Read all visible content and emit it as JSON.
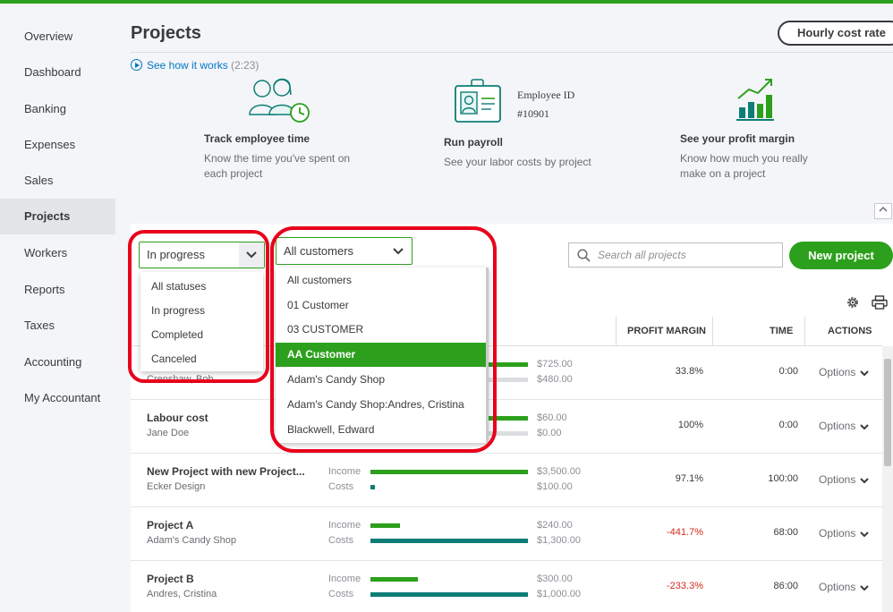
{
  "sidebar": {
    "items": [
      {
        "label": "Overview"
      },
      {
        "label": "Dashboard"
      },
      {
        "label": "Banking"
      },
      {
        "label": "Expenses"
      },
      {
        "label": "Sales"
      },
      {
        "label": "Projects"
      },
      {
        "label": "Workers"
      },
      {
        "label": "Reports"
      },
      {
        "label": "Taxes"
      },
      {
        "label": "Accounting"
      },
      {
        "label": "My Accountant"
      }
    ],
    "active": "Projects"
  },
  "header": {
    "title": "Projects",
    "hourly_cost_label": "Hourly cost rate",
    "see_how_label": "See how it works",
    "see_how_duration": "(2:23)"
  },
  "features": [
    {
      "title": "Track employee time",
      "desc": "Know the time you've spent on each project",
      "icon": "employees-clock-icon"
    },
    {
      "title": "Run payroll",
      "desc": "See your labor costs by project",
      "icon": "id-badge-icon",
      "badge_line1": "Employee ID",
      "badge_line2": "#10901"
    },
    {
      "title": "See your profit margin",
      "desc": "Know how much you really make on a project",
      "icon": "bar-chart-icon"
    }
  ],
  "filters": {
    "status_selected": "In progress",
    "status_options": [
      "All statuses",
      "In progress",
      "Completed",
      "Canceled"
    ],
    "customer_selected": "All customers",
    "customer_options": [
      "All customers",
      "01 Customer",
      "03 CUSTOMER",
      "AA Customer",
      "Adam's Candy Shop",
      "Adam's Candy Shop:Andres, Cristina",
      "Blackwell, Edward"
    ],
    "customer_highlighted": "AA Customer",
    "search_placeholder": "Search all projects",
    "new_project_label": "New project"
  },
  "table": {
    "columns": {
      "profit_margin": "PROFIT MARGIN",
      "time": "TIME",
      "actions": "ACTIONS"
    },
    "income_label": "Income",
    "costs_label": "Costs",
    "options_label": "Options",
    "rows": [
      {
        "name": "",
        "customer": "Crenshaw, Bob",
        "income": "$725.00",
        "costs": "$480.00",
        "margin": "33.8%",
        "time": "0:00",
        "income_frac": 0.21,
        "costs_frac": 0.14
      },
      {
        "name": "Labour cost",
        "customer": "Jane Doe",
        "income": "$60.00",
        "costs": "$0.00",
        "margin": "100%",
        "time": "0:00",
        "income_frac": 0.02,
        "costs_frac": 0.0
      },
      {
        "name": "New Project with new Project...",
        "customer": "Ecker Design",
        "income": "$3,500.00",
        "costs": "$100.00",
        "margin": "97.1%",
        "time": "100:00",
        "income_frac": 1.0,
        "costs_frac": 0.03
      },
      {
        "name": "Project A",
        "customer": "Adam's Candy Shop",
        "income": "$240.00",
        "costs": "$1,300.00",
        "margin": "-441.7%",
        "time": "68:00",
        "income_frac": 0.18,
        "costs_frac": 1.0
      },
      {
        "name": "Project B",
        "customer": "Andres, Cristina",
        "income": "$300.00",
        "costs": "$1,000.00",
        "margin": "-233.3%",
        "time": "86:00",
        "income_frac": 0.3,
        "costs_frac": 1.0
      }
    ]
  },
  "colors": {
    "brand_green": "#2ca01c",
    "cost_teal": "#0d7d75",
    "highlight_red": "#e8001c",
    "negative": "#d52b1e"
  }
}
